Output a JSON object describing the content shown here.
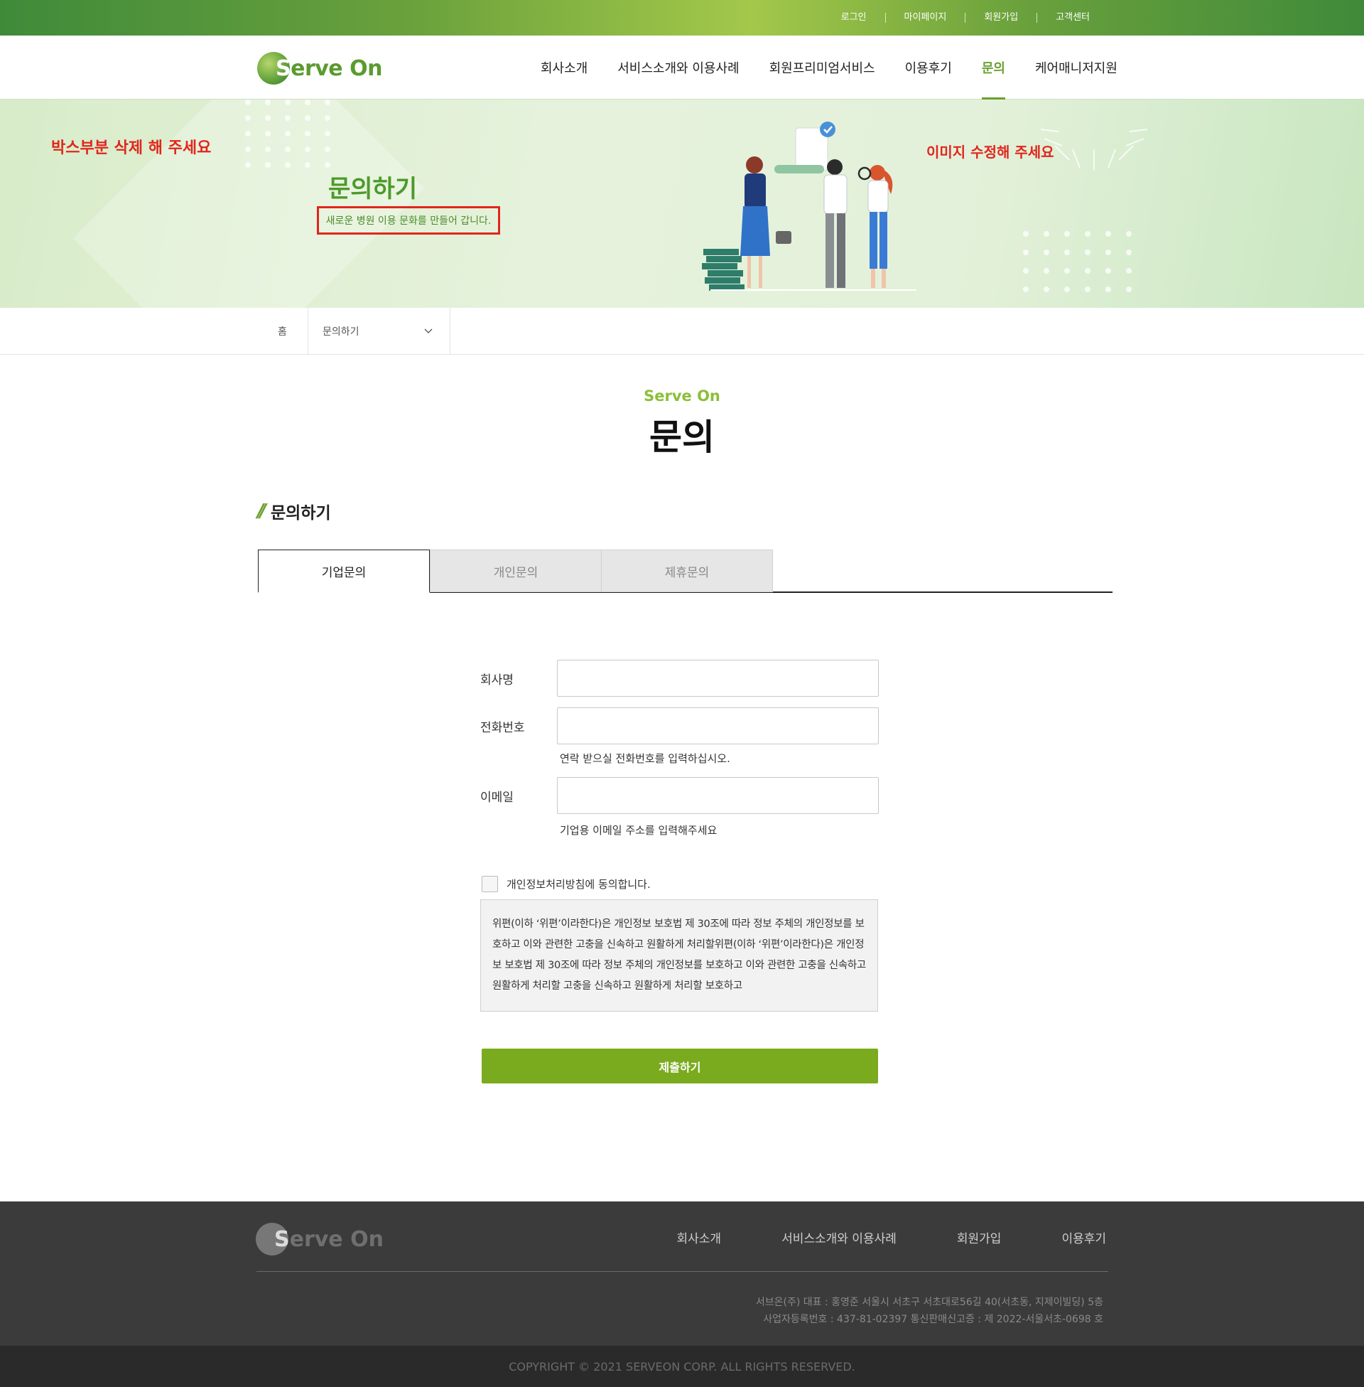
{
  "top_links": [
    "로그인",
    "마이페이지",
    "회원가입",
    "고객센터"
  ],
  "logo": {
    "s_letter": "S",
    "rest": "erve On"
  },
  "nav": [
    {
      "label": "회사소개"
    },
    {
      "label": "서비스소개와 이용사례"
    },
    {
      "label": "회원프리미엄서비스"
    },
    {
      "label": "이용후기"
    },
    {
      "label": "문의",
      "active": true
    },
    {
      "label": "케어매니저지원"
    }
  ],
  "banner": {
    "note_left": "박스부분 삭제 해 주세요",
    "note_right": "이미지 수정해 주세요",
    "title": "문의하기",
    "subtitle": "새로운 병원 이용 문화를 만들어 갑니다."
  },
  "breadcrumb": {
    "home": "홈",
    "current": "문의하기"
  },
  "hero": {
    "brand": "Serve On",
    "title": "문의"
  },
  "section_title": "문의하기",
  "tabs": [
    "기업문의",
    "개인문의",
    "제휴문의"
  ],
  "form": {
    "company_label": "회사명",
    "phone_label": "전화번호",
    "phone_hint": "연락 받으실 전화번호를 입력하십시오.",
    "email_label": "이메일",
    "email_hint": "기업용 이메일 주소를 입력해주세요",
    "agree_label": "개인정보처리방침에 동의합니다.",
    "policy_text": "위편(이하 ‘위편’이라한다)은 개인정보 보호법 제 30조에 따라 정보 주체의 개인정보를 보호하고 이와 관련한 고충을 신속하고 원활하게 처리할위편(이하 ‘위편’이라한다)은 개인정보 보호법 제 30조에 따라 정보 주체의 개인정보를 보호하고 이와 관련한 고충을 신속하고 원활하게 처리할 고충을 신속하고 원활하게 처리할 보호하고",
    "submit_label": "제출하기"
  },
  "footer": {
    "nav": [
      "회사소개",
      "서비스소개와 이용사례",
      "회원가입",
      "이용후기"
    ],
    "info_line1": "서브온(주) 대표 : 홍영준 서울시 서초구 서초대로56길 40(서초동, 지제이빌딩) 5층",
    "info_line2": "사업자등록번호 : 437-81-02397  통신판매신고증 : 제 2022-서울서초-0698 호",
    "copyright": "COPYRIGHT © 2021 SERVEON CORP. ALL RIGHTS RESERVED."
  },
  "colors": {
    "brand_green": "#6aa12e",
    "submit_green": "#7aab1e",
    "alert_red": "#e1261c"
  }
}
